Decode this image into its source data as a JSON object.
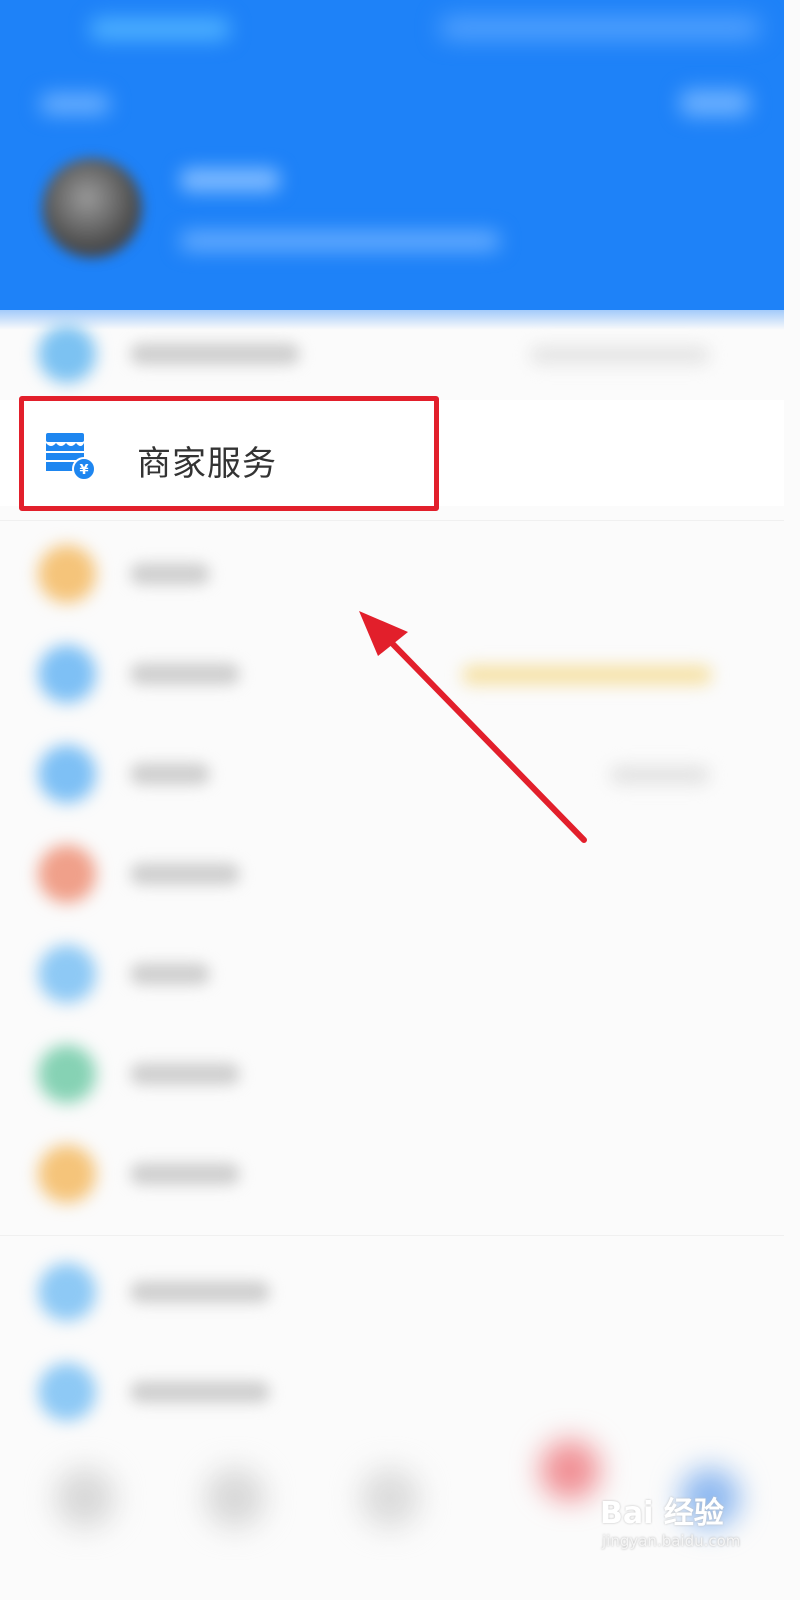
{
  "service_item": {
    "label": "商家服务"
  },
  "watermark": {
    "brand": "Bai 经验",
    "url": "jingyan.baidu.com"
  },
  "colors": {
    "header_blue": "#1e82f8",
    "highlight_red": "#e21f2b",
    "store_icon_blue": "#1e86f0"
  },
  "icons": [
    "store-yuan-icon",
    "annotation-arrow-icon"
  ]
}
